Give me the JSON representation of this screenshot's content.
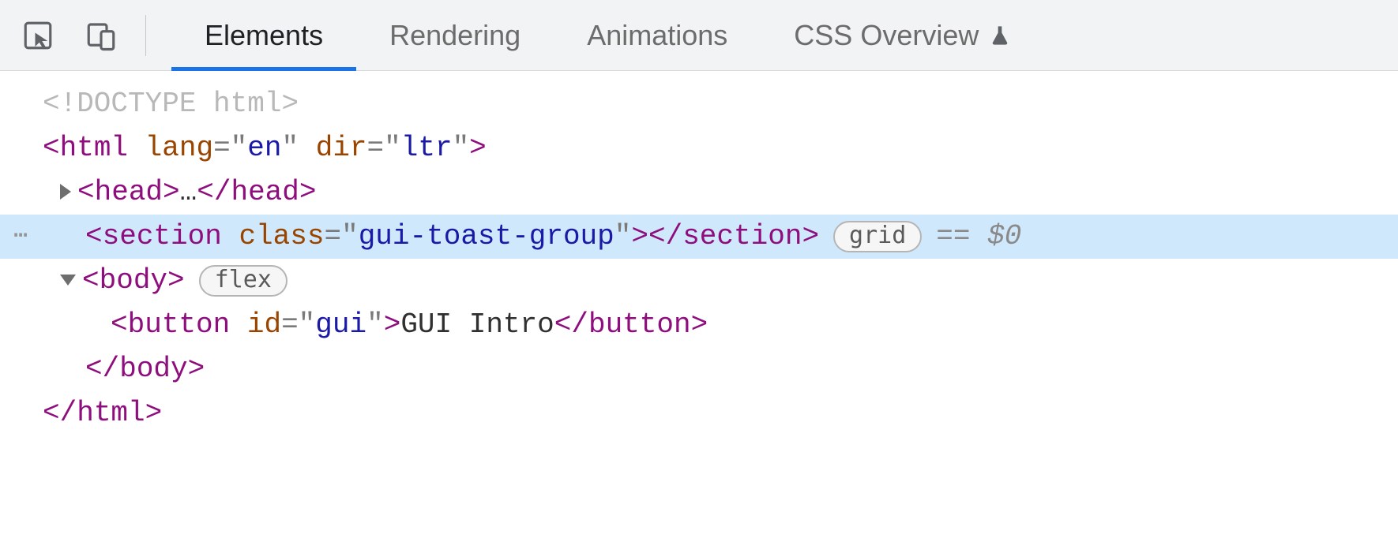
{
  "tabs": {
    "elements": "Elements",
    "rendering": "Rendering",
    "animations": "Animations",
    "css_overview": "CSS Overview"
  },
  "dom": {
    "doctype": "<!DOCTYPE html>",
    "html_open": {
      "tag": "html",
      "attrs": [
        {
          "name": "lang",
          "value": "en"
        },
        {
          "name": "dir",
          "value": "ltr"
        }
      ]
    },
    "head": {
      "tag": "head",
      "collapsed_text": "…"
    },
    "section": {
      "tag": "section",
      "attr_name": "class",
      "attr_value": "gui-toast-group",
      "layout_badge": "grid",
      "selected_ref": "== $0"
    },
    "body": {
      "tag": "body",
      "layout_badge": "flex"
    },
    "button": {
      "tag": "button",
      "attr_name": "id",
      "attr_value": "gui",
      "text": " GUI Intro "
    },
    "body_close": "body",
    "html_close": "html"
  },
  "gutter_dots": "⋯"
}
